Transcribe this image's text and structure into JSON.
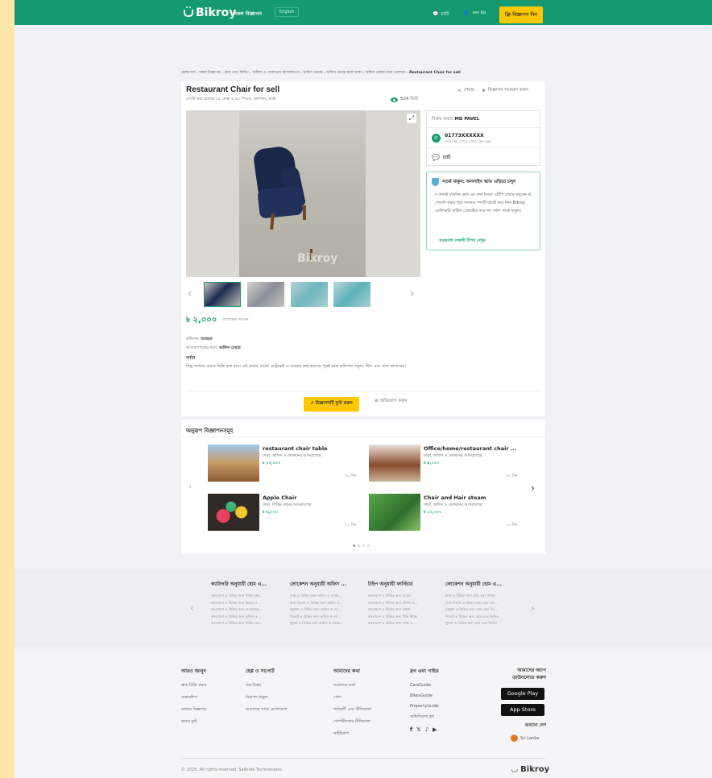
{
  "header": {
    "logo": "Bikroy",
    "all_ads": "সকল বিজ্ঞাপন",
    "language": "English",
    "chat": "চ্যাট",
    "login": "লগ ইন",
    "post_ad": "ফ্রি বিজ্ঞাপন দিন",
    "brand_color": "#159a6f",
    "accent_color": "#ffc800"
  },
  "breadcrumb": {
    "path": "হোমপেজ › সকল বিজ্ঞাপন › হোম এবং লিভিং › অফিস ও দোকানের আসবাবপত্র › অফিস চেয়ার › অফিস চেয়ার মধ্যে ঢাকা › অফিস চেয়ার মধ্যে গুলশান ›",
    "current": "Restaurant Chair for sell"
  },
  "ad": {
    "title": "Restaurant Chair for sell",
    "subtitle": "পোস্ট করা হয়েছে ১৫ ফেব্রু ৫:৪০ পিএম, গুলশান, ঢাকা",
    "share": "শেয়ার",
    "save": "বিজ্ঞাপন সংরক্ষণ করুন",
    "views": "524 ভিউ",
    "watermark": "Bikroy",
    "price": "৳ ২,০০০",
    "negotiable": "আলোচনা সাপেক্ষ",
    "condition_label": "কন্ডিশন:",
    "condition_value": "ব্যবহৃত",
    "type_label": "আসবাবপত্রের ধরণ:",
    "type_value": "অফিস চেয়ার",
    "description_heading": "বর্ণনা",
    "description": "কিছু সংখ্যক চেয়ার বিক্রি করা হবে। এই চেয়ার গুলো রেস্টুরেন্ট এ ব্যবহার করা হয়েছে। খুবই ভাল কন্ডিশন। সবুজ, নীল এবং সাদা কালারের।",
    "promote": "বিজ্ঞাপনটি বুস্ট করুন",
    "report": "অভিযোগ করুন"
  },
  "seller": {
    "sold_by_label": "বিক্রয় করছে",
    "name": "MD PAVEL",
    "phone": "01773XXXXXX",
    "phone_hint": "ফোন নম্বর দেখতে এখানে ক্লিক করুন",
    "chat": "চ্যাট"
  },
  "safety": {
    "heading": "সতর্ক থাকুন: অনলাইন স্ক্যাম এড়িয়ে চলুন",
    "text": "• কখনই ব্যাংকিং কার্ড এর তথ্য কিংবা ওটিপি শেয়ার করবেন না, পেমেন্ট করার পূর্বে সবসময় পণ্যটি যাচাই করে নিন। Bikroy ডেলিভারি সার্ভিস প্রোভাইড করে না। সর্বদা সতর্ক থাকুন।",
    "link": "সবগুলো সেফটি টিপস দেখুন"
  },
  "similar": {
    "heading": "অনুরূপ বিজ্ঞাপনসমূহ",
    "items": [
      {
        "name": "restaurant chair table",
        "location": "ঢাকা, অফিস ও দোকানের আসবাবপত্র",
        "price": "৳ ১২,০০০",
        "age": "৩০ দিন"
      },
      {
        "name": "Office/home/restaurant chair ...",
        "location": "ঢাকা, অফিস ও দোকানের আসবাবপত্র",
        "price": "৳ ৪,০০০",
        "age": "৩৮ দিন"
      },
      {
        "name": "Apple Chair",
        "location": "ঢাকা, লিভিং রুমের আসবাবপত্র",
        "price": "৳ ৬,০০০",
        "age": "২২ দিন"
      },
      {
        "name": "Chair and Hair steam",
        "location": "ঢাকা, অফিস ও দোকানের আসবাবপত্র",
        "price": "৳ ১২,০০০",
        "age": "১১ দিন"
      }
    ]
  },
  "categories": [
    {
      "heading": "ক্যাটাগরি অনুযায়ী হোম এ...",
      "lines": [
        "বাংলাদেশ এ বিক্রির জন্য লিভিং রুম...",
        "বাংলাদেশ এ বিক্রির জন্য কিচেন ও...",
        "বাংলাদেশ এ বিক্রির জন্য বেডরুমের...",
        "বাংলাদেশ এ বিক্রির জন্য অফিস ও...",
        "বাংলাদেশ এ বিক্রির জন্য লিভিং রুম..."
      ]
    },
    {
      "heading": "লোকেশন অনুযায়ী অফিস ...",
      "lines": [
        "ঢাকা এ বিক্রির জন্য অফিস ও দোকা...",
        "ঢাকা বিভাগ এ বিক্রির জন্য অফিস ও...",
        "চট্টগ্রাম এ বিক্রির জন্য অফিস ও দো...",
        "সিলেট এ বিক্রির জন্য অফিস ও দো...",
        "খুলনা এ বিক্রির জন্য অফিস ও দোকা..."
      ]
    },
    {
      "heading": "টাইপ অনুযায়ী ফার্নিচার",
      "lines": [
        "বাংলাদেশ এ বিক্রির জন্য চেয়ার",
        "বাংলাদেশ এ বিক্রির জন্য টেবিল ও...",
        "বাংলাদেশ এ বিক্রির জন্য সোফা",
        "বাংলাদেশ এ বিক্রির জন্য টিভি স্ট্যান্ড",
        "বাংলাদেশ এ বিক্রির জন্য শেল্ফ ও..."
      ]
    },
    {
      "heading": "লোকেশন অনুযায়ী হোম এ...",
      "lines": [
        "ঢাকা এ বিক্রির জন্য হোম এবং লিভিং",
        "ঢাকা বিভাগ এ বিক্রির জন্য হোম এব...",
        "চট্টগ্রাম এ বিক্রির জন্য হোম এবং লি...",
        "সিলেট এ বিক্রির জন্য হোম এবং লিভিং",
        "খুলনা এ বিক্রির জন্য হোম এবং লিভিং"
      ]
    }
  ],
  "footer": {
    "col1": {
      "heading": "আরও জানুন",
      "links": [
        "দ্রুত বিক্রি করুন",
        "মেম্বারশিপ",
        "ব্যানার বিজ্ঞাপন",
        "অ্যাড বুস্ট"
      ]
    },
    "col2": {
      "heading": "হেল্প ও সাপোর্ট",
      "links": [
        "প্রশ্ন-উত্তর",
        "নিরাপদ থাকুন",
        "আমাদের সাথে যোগাযোগ"
      ]
    },
    "col3": {
      "heading": "আমাদের কথা",
      "links": [
        "আমাদের কথা",
        "পেশা",
        "শর্তাবলী এবং নীতিমালা",
        "গোপনীয়তার নীতিমালা",
        "সাইটম্যাপ"
      ]
    },
    "col4": {
      "heading": "ব্লগ এবং গাইড",
      "links": [
        "CarsGuide",
        "BikesGuide",
        "PropertyGuide",
        "অফিসিয়াল ব্লগ"
      ]
    },
    "app_heading": "আমাদের অ্যাপ ডাউনলোড করুন",
    "google_play": "Google Play",
    "app_store": "App Store",
    "other_countries": "অন্যান্য দেশ",
    "country": "Sri Lanka",
    "copyright": "© 2025. All rights reserved. Saltside Technologies",
    "logo": "Bikroy"
  }
}
